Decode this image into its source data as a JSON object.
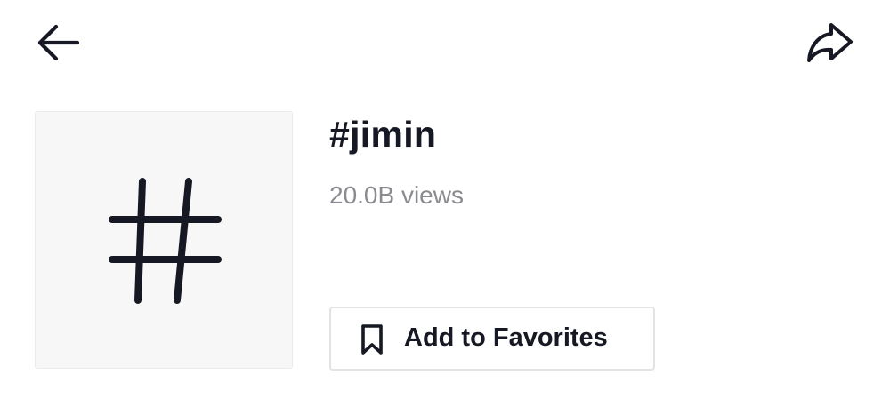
{
  "header": {
    "back_icon": "arrow-left-icon",
    "share_icon": "share-arrow-icon"
  },
  "hashtag": {
    "cover_icon": "hashtag-icon",
    "title": "#jimin",
    "views": "20.0B views"
  },
  "actions": {
    "favorite_icon": "bookmark-icon",
    "favorite_label": "Add to Favorites"
  }
}
